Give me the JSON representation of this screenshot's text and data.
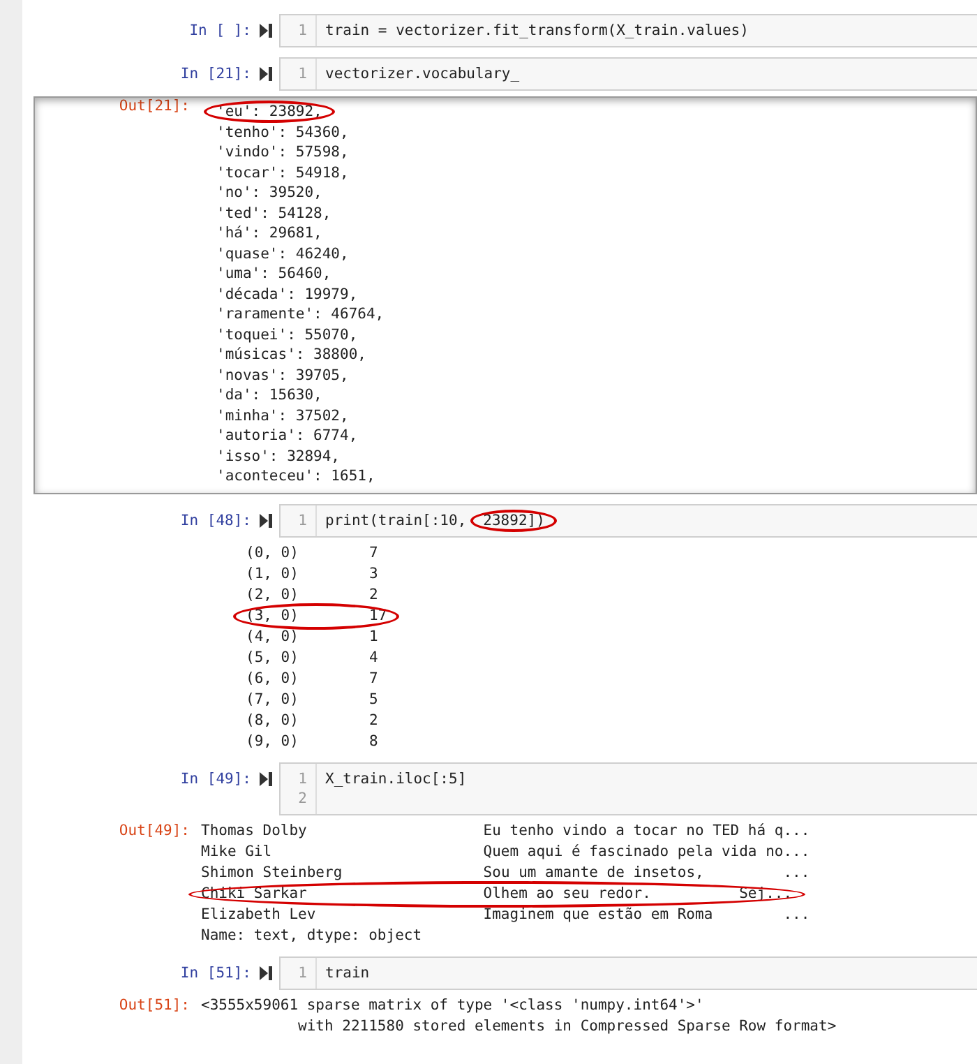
{
  "cells": [
    {
      "prompt": "In [ ]:",
      "code": [
        {
          "number": "1",
          "segments": [
            {
              "text": "train = vectorizer.fit_transform(X_train.values)",
              "circled": false
            }
          ]
        }
      ]
    },
    {
      "prompt": "In [21]:",
      "code": [
        {
          "number": "1",
          "segments": [
            {
              "text": "vectorizer.vocabulary_",
              "circled": false
            }
          ]
        }
      ],
      "output": {
        "prompt": "Out[21]:",
        "kind": "scrolled",
        "lines": [
          {
            "cells": [
              "'eu': 23892,"
            ],
            "circled": true
          },
          {
            "cells": [
              "'tenho': 54360,"
            ],
            "circled": false
          },
          {
            "cells": [
              "'vindo': 57598,"
            ],
            "circled": false
          },
          {
            "cells": [
              "'tocar': 54918,"
            ],
            "circled": false
          },
          {
            "cells": [
              "'no': 39520,"
            ],
            "circled": false
          },
          {
            "cells": [
              "'ted': 54128,"
            ],
            "circled": false
          },
          {
            "cells": [
              "'há': 29681,"
            ],
            "circled": false
          },
          {
            "cells": [
              "'quase': 46240,"
            ],
            "circled": false
          },
          {
            "cells": [
              "'uma': 56460,"
            ],
            "circled": false
          },
          {
            "cells": [
              "'década': 19979,"
            ],
            "circled": false
          },
          {
            "cells": [
              "'raramente': 46764,"
            ],
            "circled": false
          },
          {
            "cells": [
              "'toquei': 55070,"
            ],
            "circled": false
          },
          {
            "cells": [
              "'músicas': 38800,"
            ],
            "circled": false
          },
          {
            "cells": [
              "'novas': 39705,"
            ],
            "circled": false
          },
          {
            "cells": [
              "'da': 15630,"
            ],
            "circled": false
          },
          {
            "cells": [
              "'minha': 37502,"
            ],
            "circled": false
          },
          {
            "cells": [
              "'autoria': 6774,"
            ],
            "circled": false
          },
          {
            "cells": [
              "'isso': 32894,"
            ],
            "circled": false
          },
          {
            "cells": [
              "'aconteceu': 1651,"
            ],
            "circled": false
          }
        ]
      }
    },
    {
      "prompt": "In [48]:",
      "code": [
        {
          "number": "1",
          "segments": [
            {
              "text": "print(train[:10,",
              "circled": false
            },
            {
              "text": "23892])",
              "circled": true
            }
          ]
        }
      ],
      "output": {
        "kind": "pairs",
        "lines": [
          {
            "cells": [
              "(0, 0)",
              "7"
            ],
            "circled": false
          },
          {
            "cells": [
              "(1, 0)",
              "3"
            ],
            "circled": false
          },
          {
            "cells": [
              "(2, 0)",
              "2"
            ],
            "circled": false
          },
          {
            "cells": [
              "(3, 0)",
              "17"
            ],
            "circled": true
          },
          {
            "cells": [
              "(4, 0)",
              "1"
            ],
            "circled": false
          },
          {
            "cells": [
              "(5, 0)",
              "4"
            ],
            "circled": false
          },
          {
            "cells": [
              "(6, 0)",
              "7"
            ],
            "circled": false
          },
          {
            "cells": [
              "(7, 0)",
              "5"
            ],
            "circled": false
          },
          {
            "cells": [
              "(8, 0)",
              "2"
            ],
            "circled": false
          },
          {
            "cells": [
              "(9, 0)",
              "8"
            ],
            "circled": false
          }
        ]
      }
    },
    {
      "prompt": "In [49]:",
      "code": [
        {
          "number": "1",
          "segments": [
            {
              "text": "X_train.iloc[:5]",
              "circled": false
            }
          ]
        },
        {
          "number": "2"
        }
      ],
      "output": {
        "prompt": "Out[49]:",
        "kind": "series",
        "lines": [
          {
            "cells": [
              "Thomas Dolby",
              "Eu tenho vindo a tocar no TED há q..."
            ],
            "circled": false
          },
          {
            "cells": [
              "Mike Gil",
              "Quem aqui é fascinado pela vida no..."
            ],
            "circled": false
          },
          {
            "cells": [
              "Shimon Steinberg",
              "Sou um amante de insetos,         ..."
            ],
            "circled": false
          },
          {
            "cells": [
              "Chiki Sarkar",
              "Olhem ao seu redor.          Sej..."
            ],
            "circled": true
          },
          {
            "cells": [
              "Elizabeth Lev",
              "Imaginem que estão em Roma        ..."
            ],
            "circled": false
          },
          {
            "cells": [
              "Name: text, dtype: object"
            ],
            "circled": false
          }
        ]
      }
    },
    {
      "prompt": "In [51]:",
      "code": [
        {
          "number": "1",
          "segments": [
            {
              "text": "train",
              "circled": false
            }
          ]
        }
      ],
      "output": {
        "prompt": "Out[51]:",
        "kind": "plain",
        "lines": [
          {
            "cells": [
              "<3555x59061 sparse matrix of type '<class 'numpy.int64'>'"
            ],
            "circled": false
          },
          {
            "cells": [
              "\twith 2211580 stored elements in Compressed Sparse Row format>"
            ],
            "circled": false
          }
        ]
      }
    }
  ]
}
